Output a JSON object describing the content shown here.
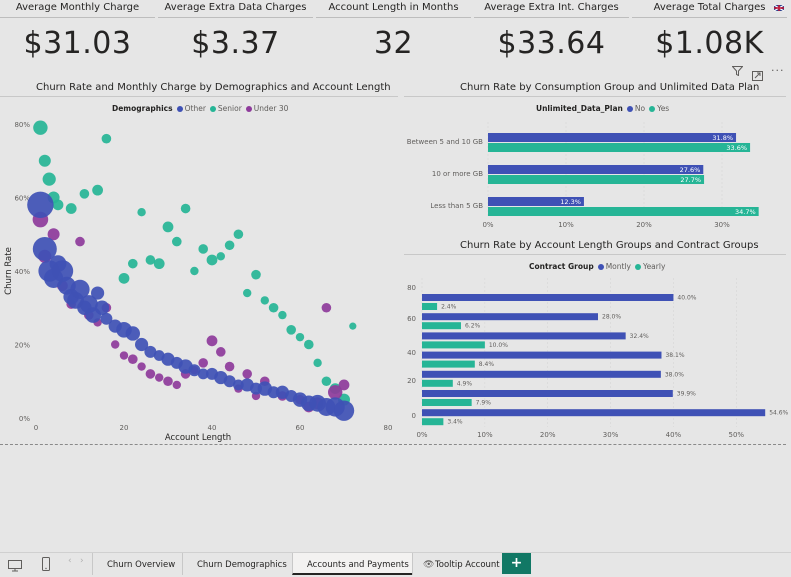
{
  "kpis": [
    {
      "label": "Average Monthly Charge",
      "value": "$31.03"
    },
    {
      "label": "Average Extra Data Charges",
      "value": "$3.37"
    },
    {
      "label": "Account Length in Months",
      "value": "32"
    },
    {
      "label": "Average Extra Int. Charges",
      "value": "$33.64"
    },
    {
      "label": "Average Total Charges",
      "value": "$1.08K"
    }
  ],
  "colors": {
    "other": "#3f51b5",
    "senior": "#26b596",
    "under30": "#8e3b9b",
    "no": "#3f51b5",
    "yes": "#26b596",
    "monthly": "#3f51b5",
    "yearly": "#26b596",
    "accent": "#117865"
  },
  "scatter": {
    "title": "Churn Rate and Monthly Charge by Demographics and Account Length",
    "legend_title": "Demographics",
    "legend": [
      "Other",
      "Senior",
      "Under 30"
    ],
    "xlabel": "Account Length",
    "ylabel": "Churn Rate"
  },
  "consumption": {
    "title": "Churn Rate by Consumption Group and Unlimited Data Plan",
    "legend_title": "Unlimited_Data_Plan",
    "legend": [
      "No",
      "Yes"
    ]
  },
  "contract": {
    "title": "Churn Rate by Account Length Groups and Contract Groups",
    "legend_title": "Contract Group",
    "legend": [
      "Montly",
      "Yearly"
    ]
  },
  "chart_data": [
    {
      "type": "scatter",
      "title": "Churn Rate and Monthly Charge by Demographics and Account Length",
      "xlabel": "Account Length",
      "ylabel": "Churn Rate",
      "xlim": [
        0,
        80
      ],
      "ylim": [
        0,
        0.8
      ],
      "x_ticks": [
        "0",
        "20",
        "40",
        "60",
        "80"
      ],
      "y_ticks": [
        "0%",
        "20%",
        "40%",
        "60%",
        "80%"
      ],
      "series": [
        {
          "name": "Other",
          "points": [
            [
              1,
              0.58,
              2.2
            ],
            [
              2,
              0.46,
              2.0
            ],
            [
              3,
              0.4,
              1.8
            ],
            [
              4,
              0.38,
              1.6
            ],
            [
              5,
              0.42,
              1.4
            ],
            [
              6,
              0.4,
              1.8
            ],
            [
              7,
              0.36,
              1.5
            ],
            [
              8,
              0.33,
              1.3
            ],
            [
              9,
              0.32,
              1.4
            ],
            [
              10,
              0.35,
              1.6
            ],
            [
              11,
              0.3,
              1.2
            ],
            [
              12,
              0.31,
              1.5
            ],
            [
              13,
              0.28,
              1.3
            ],
            [
              14,
              0.34,
              1.1
            ],
            [
              15,
              0.3,
              1.2
            ],
            [
              16,
              0.27,
              1.0
            ],
            [
              18,
              0.25,
              1.1
            ],
            [
              20,
              0.24,
              1.3
            ],
            [
              22,
              0.23,
              1.2
            ],
            [
              24,
              0.2,
              1.1
            ],
            [
              26,
              0.18,
              1.0
            ],
            [
              28,
              0.17,
              0.9
            ],
            [
              30,
              0.16,
              1.1
            ],
            [
              32,
              0.15,
              1.0
            ],
            [
              34,
              0.14,
              1.2
            ],
            [
              36,
              0.13,
              1.0
            ],
            [
              38,
              0.12,
              0.9
            ],
            [
              40,
              0.12,
              1.0
            ],
            [
              42,
              0.11,
              1.1
            ],
            [
              44,
              0.1,
              1.0
            ],
            [
              46,
              0.09,
              0.9
            ],
            [
              48,
              0.09,
              1.1
            ],
            [
              50,
              0.08,
              1.0
            ],
            [
              52,
              0.08,
              1.2
            ],
            [
              54,
              0.07,
              1.0
            ],
            [
              56,
              0.07,
              1.1
            ],
            [
              58,
              0.06,
              1.0
            ],
            [
              60,
              0.05,
              1.2
            ],
            [
              62,
              0.04,
              1.3
            ],
            [
              64,
              0.04,
              1.4
            ],
            [
              66,
              0.03,
              1.5
            ],
            [
              68,
              0.03,
              1.6
            ],
            [
              70,
              0.02,
              1.7
            ]
          ]
        },
        {
          "name": "Senior",
          "points": [
            [
              1,
              0.79,
              1.2
            ],
            [
              2,
              0.7,
              1.0
            ],
            [
              3,
              0.65,
              1.1
            ],
            [
              4,
              0.6,
              1.0
            ],
            [
              5,
              0.58,
              0.9
            ],
            [
              8,
              0.57,
              0.9
            ],
            [
              11,
              0.61,
              0.8
            ],
            [
              14,
              0.62,
              0.9
            ],
            [
              16,
              0.76,
              0.8
            ],
            [
              20,
              0.38,
              0.9
            ],
            [
              22,
              0.42,
              0.8
            ],
            [
              24,
              0.56,
              0.7
            ],
            [
              26,
              0.43,
              0.8
            ],
            [
              28,
              0.42,
              0.9
            ],
            [
              30,
              0.52,
              0.9
            ],
            [
              32,
              0.48,
              0.8
            ],
            [
              34,
              0.57,
              0.8
            ],
            [
              36,
              0.4,
              0.7
            ],
            [
              38,
              0.46,
              0.8
            ],
            [
              40,
              0.43,
              0.9
            ],
            [
              42,
              0.44,
              0.7
            ],
            [
              44,
              0.47,
              0.8
            ],
            [
              46,
              0.5,
              0.8
            ],
            [
              48,
              0.34,
              0.7
            ],
            [
              50,
              0.39,
              0.8
            ],
            [
              52,
              0.32,
              0.7
            ],
            [
              54,
              0.3,
              0.8
            ],
            [
              56,
              0.28,
              0.7
            ],
            [
              58,
              0.24,
              0.8
            ],
            [
              60,
              0.22,
              0.7
            ],
            [
              62,
              0.2,
              0.8
            ],
            [
              64,
              0.15,
              0.7
            ],
            [
              66,
              0.1,
              0.8
            ],
            [
              68,
              0.08,
              0.9
            ],
            [
              70,
              0.05,
              1.0
            ],
            [
              72,
              0.25,
              0.6
            ]
          ]
        },
        {
          "name": "Under 30",
          "points": [
            [
              1,
              0.54,
              1.3
            ],
            [
              2,
              0.44,
              1.1
            ],
            [
              4,
              0.5,
              1.0
            ],
            [
              6,
              0.36,
              0.9
            ],
            [
              8,
              0.31,
              0.8
            ],
            [
              10,
              0.48,
              0.8
            ],
            [
              12,
              0.28,
              0.8
            ],
            [
              14,
              0.26,
              0.7
            ],
            [
              16,
              0.3,
              0.8
            ],
            [
              18,
              0.2,
              0.7
            ],
            [
              20,
              0.17,
              0.7
            ],
            [
              22,
              0.16,
              0.8
            ],
            [
              24,
              0.14,
              0.7
            ],
            [
              26,
              0.12,
              0.8
            ],
            [
              28,
              0.11,
              0.7
            ],
            [
              30,
              0.1,
              0.8
            ],
            [
              32,
              0.09,
              0.7
            ],
            [
              34,
              0.12,
              0.8
            ],
            [
              36,
              0.13,
              0.7
            ],
            [
              38,
              0.15,
              0.8
            ],
            [
              40,
              0.21,
              0.9
            ],
            [
              42,
              0.18,
              0.8
            ],
            [
              44,
              0.14,
              0.8
            ],
            [
              46,
              0.08,
              0.7
            ],
            [
              48,
              0.12,
              0.8
            ],
            [
              50,
              0.06,
              0.7
            ],
            [
              52,
              0.1,
              0.8
            ],
            [
              56,
              0.06,
              0.8
            ],
            [
              60,
              0.05,
              0.8
            ],
            [
              62,
              0.03,
              0.9
            ],
            [
              64,
              0.04,
              1.0
            ],
            [
              66,
              0.3,
              0.8
            ],
            [
              68,
              0.07,
              1.2
            ],
            [
              70,
              0.09,
              0.9
            ]
          ]
        }
      ]
    },
    {
      "type": "bar",
      "orientation": "horizontal",
      "title": "Churn Rate by Consumption Group and Unlimited Data Plan",
      "categories": [
        "Between 5 and 10 GB",
        "10 or more GB",
        "Less than 5 GB"
      ],
      "series": [
        {
          "name": "No",
          "values": [
            0.318,
            0.276,
            0.123
          ],
          "labels": [
            "31.8%",
            "27.6%",
            "12.3%"
          ]
        },
        {
          "name": "Yes",
          "values": [
            0.336,
            0.277,
            0.347
          ],
          "labels": [
            "33.6%",
            "27.7%",
            "34.7%"
          ]
        }
      ],
      "x_ticks": [
        "0%",
        "10%",
        "20%",
        "30%"
      ],
      "xlim": [
        0,
        0.35
      ]
    },
    {
      "type": "bar",
      "orientation": "horizontal",
      "title": "Churn Rate by Account Length Groups and Contract Groups",
      "categories": [
        "80",
        "",
        "60",
        "",
        "40",
        "20",
        "",
        "0"
      ],
      "series": [
        {
          "name": "Montly",
          "values": [
            0.4,
            0.28,
            0.324,
            0.381,
            0.38,
            0.399,
            0.546
          ],
          "labels": [
            "40.0%",
            "28.0%",
            "32.4%",
            "38.1%",
            "38.0%",
            "39.9%",
            "54.6%"
          ]
        },
        {
          "name": "Yearly",
          "values": [
            0.024,
            0.062,
            0.1,
            0.084,
            0.049,
            0.079,
            0.034
          ],
          "labels": [
            "2.4%",
            "6.2%",
            "10.0%",
            "8.4%",
            "4.9%",
            "7.9%",
            "3.4%"
          ]
        }
      ],
      "y_ticks": [
        "80",
        "60",
        "40",
        "20",
        "0"
      ],
      "x_ticks": [
        "0%",
        "10%",
        "20%",
        "30%",
        "40%",
        "50%"
      ],
      "xlim": [
        0,
        0.56
      ]
    }
  ],
  "tabs": [
    "Churn Overview",
    "Churn Demographics",
    "Accounts and Payments",
    "Tooltip Account"
  ],
  "add_label": "+"
}
